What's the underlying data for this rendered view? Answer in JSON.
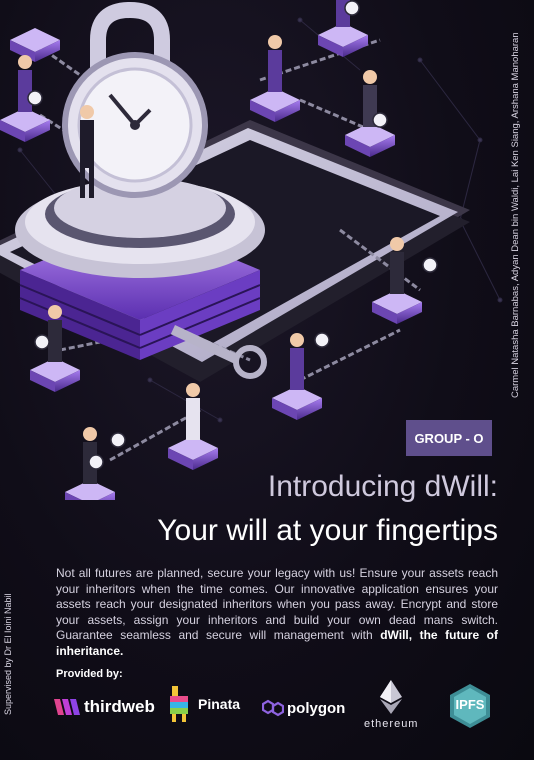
{
  "authors": "Carmel Natasha Barnabas, Adyan Dean bin Waldi, Lai Ken Siang, Arshana Manoharan",
  "supervisor": "Supervised by Dr El Ioini Nabil",
  "group_badge": "GROUP - O",
  "title_line1": "Introducing dWill:",
  "title_line2": "Your will at your fingertips",
  "description_main": "Not all futures are planned, secure your legacy with us! Ensure your assets reach your inheritors when the time comes. Our innovative application ensures your assets reach your designated inheritors when you pass away. Encrypt and store your assets, assign your inheritors and build your own dead mans switch. Guarantee seamless and secure will management with ",
  "description_bold": "dWill, the future of inheritance.",
  "provided_by": "Provided by:",
  "logos": {
    "thirdweb": "thirdweb",
    "pinata": "Pinata",
    "polygon": "polygon",
    "ethereum": "ethereum",
    "ipfs": "IPFS"
  },
  "colors": {
    "accent": "#5f4f8c",
    "purple": "#8e63e0",
    "background": "#100d18"
  }
}
